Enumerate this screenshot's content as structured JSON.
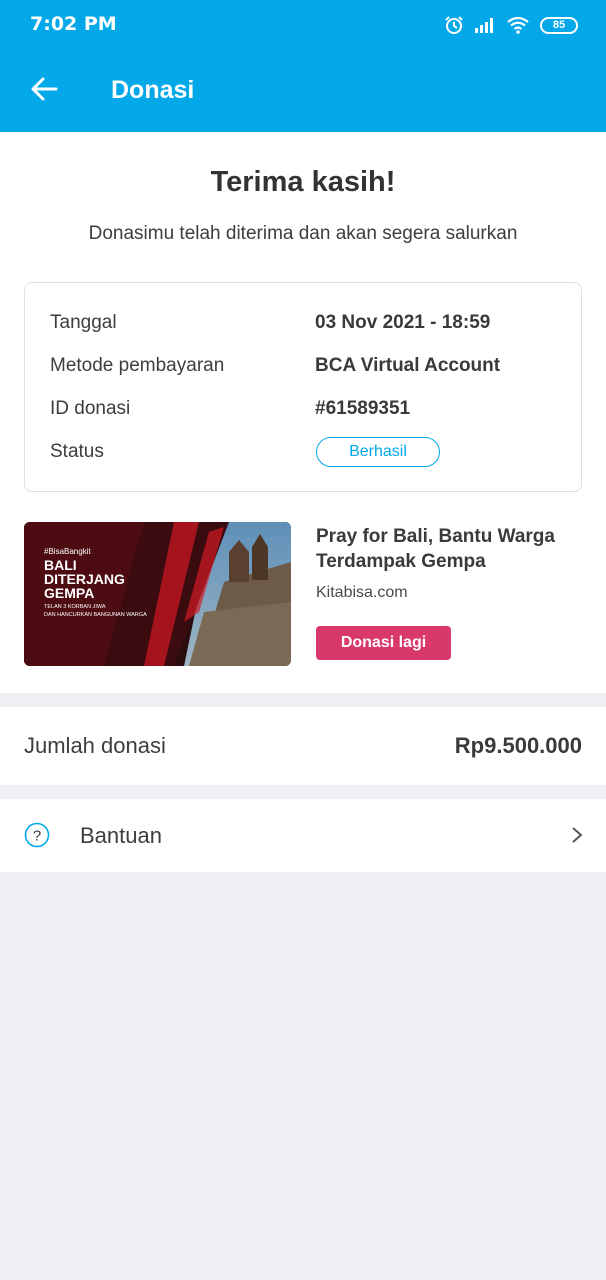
{
  "status_bar": {
    "time": "7:02 PM",
    "battery": "85"
  },
  "app_bar": {
    "title": "Donasi"
  },
  "receipt": {
    "heading": "Terima kasih!",
    "subheading": "Donasimu telah diterima dan akan segera salurkan",
    "rows": [
      {
        "label": "Tanggal",
        "value": "03 Nov 2021 - 18:59"
      },
      {
        "label": "Metode pembayaran",
        "value": "BCA Virtual Account"
      },
      {
        "label": "ID donasi",
        "value": "#61589351"
      },
      {
        "label": "Status",
        "value": "Berhasil"
      }
    ]
  },
  "campaign": {
    "image_text": {
      "tag": "#BisaBangkit",
      "line1": "BALI",
      "line2": "DITERJANG",
      "line3": "GEMPA",
      "caption1": "TELAN 3 KORBAN JIWA",
      "caption2": "DAN HANCURKAN BANGUNAN WARGA"
    },
    "title": "Pray for Bali, Bantu Warga Terdampak Gempa",
    "source": "Kitabisa.com",
    "button": "Donasi lagi"
  },
  "amount": {
    "label": "Jumlah donasi",
    "value": "Rp9.500.000"
  },
  "help": {
    "label": "Bantuan"
  },
  "colors": {
    "primary": "#02a8e8",
    "accent": "#d9386a",
    "background": "#eef0f3"
  }
}
